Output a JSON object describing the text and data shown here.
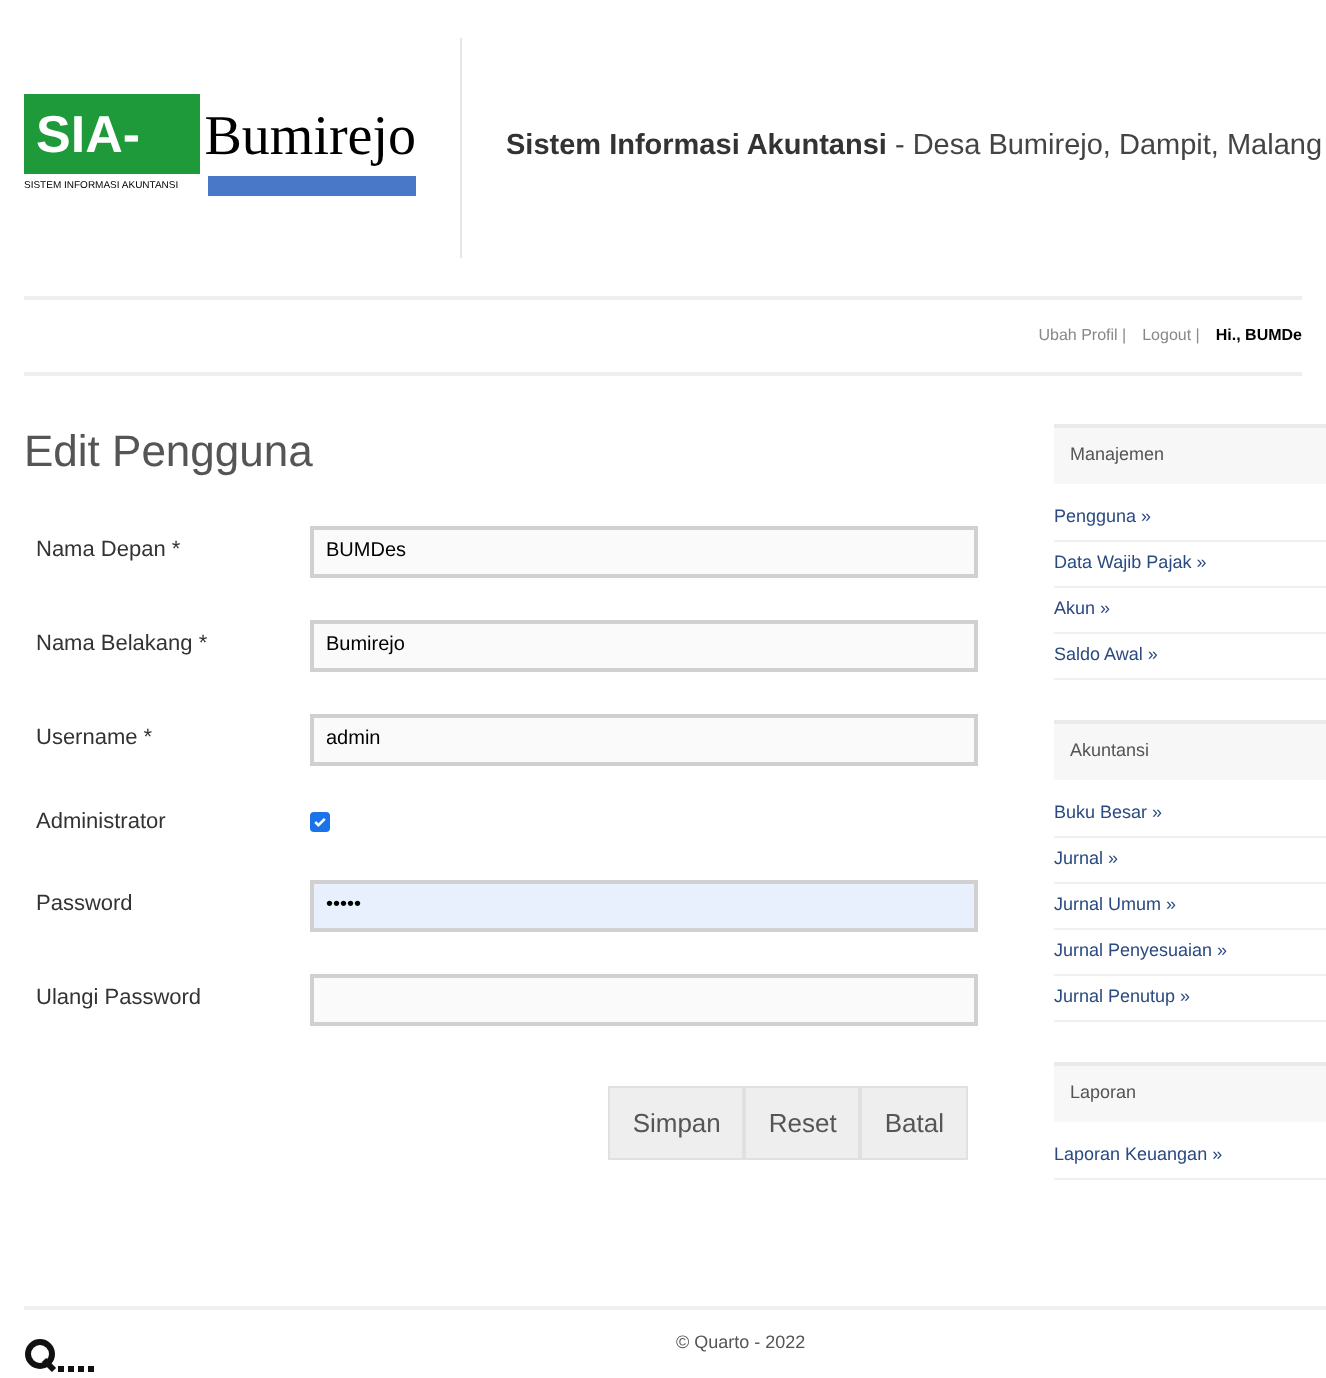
{
  "header": {
    "logo": {
      "left": "SIA-",
      "right": "Bumirejo",
      "tagline": "SISTEM INFORMASI AKUNTANSI"
    },
    "title_bold": "Sistem Informasi Akuntansi",
    "title_rest": " - Desa Bumirejo, Dampit, Malang"
  },
  "nav": {
    "links": [
      "Ubah Profil |",
      "Logout |"
    ],
    "greeting": "Hi., BUMDe"
  },
  "form": {
    "title": "Edit Pengguna",
    "fields": [
      {
        "kind": "text",
        "label": "Nama Depan *",
        "value": "BUMDes",
        "focused": false
      },
      {
        "kind": "text",
        "label": "Nama Belakang *",
        "value": "Bumirejo",
        "focused": false
      },
      {
        "kind": "text",
        "label": "Username *",
        "value": "admin",
        "focused": false
      },
      {
        "kind": "checkbox",
        "label": "Administrator",
        "checked": true
      },
      {
        "kind": "password",
        "label": "Password",
        "value": "•••••",
        "focused": true
      },
      {
        "kind": "password",
        "label": "Ulangi Password",
        "focused": false
      }
    ],
    "buttons": [
      "Simpan",
      "Reset",
      "Batal"
    ]
  },
  "sidebar": [
    {
      "title": "Manajemen",
      "links": [
        "Pengguna »",
        "Data Wajib Pajak »",
        "Akun »",
        "Saldo Awal »"
      ]
    },
    {
      "title": "Akuntansi",
      "links": [
        "Buku Besar »",
        "Jurnal »",
        "Jurnal Umum »",
        "Jurnal Penyesuaian »",
        "Jurnal Penutup »"
      ]
    },
    {
      "title": "Laporan",
      "links": [
        "Laporan Keuangan »"
      ]
    }
  ],
  "footer": {
    "copyright": "© Quarto - 2022"
  }
}
